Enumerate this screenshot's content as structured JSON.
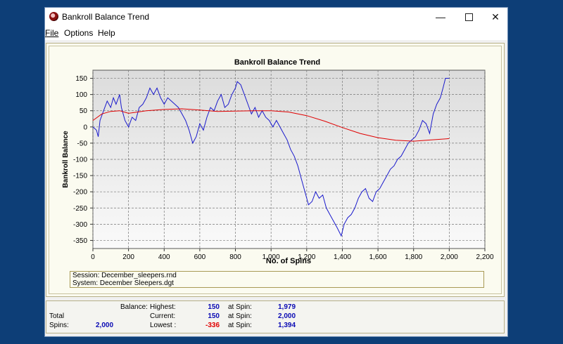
{
  "window": {
    "title": "Bankroll Balance Trend"
  },
  "menu": {
    "file": "File",
    "options": "Options",
    "help": "Help"
  },
  "chart_data": {
    "type": "line",
    "title": "Bankroll Balance Trend",
    "xlabel": "No. of Spins",
    "ylabel": "Bankroll Balance",
    "xlim": [
      0,
      2200
    ],
    "ylim": [
      -375,
      175
    ],
    "x_ticks": [
      "0",
      "200",
      "400",
      "600",
      "800",
      "1,000",
      "1,200",
      "1,400",
      "1,600",
      "1,800",
      "2,000",
      "2,200"
    ],
    "y_ticks": [
      "150",
      "100",
      "50",
      "0",
      "-50",
      "-100",
      "-150",
      "-200",
      "-250",
      "-300",
      "-350"
    ],
    "grid": true,
    "series": [
      {
        "color": "#1a1acc",
        "points": [
          [
            0,
            0
          ],
          [
            20,
            -10
          ],
          [
            30,
            -30
          ],
          [
            40,
            20
          ],
          [
            60,
            50
          ],
          [
            80,
            80
          ],
          [
            100,
            60
          ],
          [
            115,
            90
          ],
          [
            130,
            70
          ],
          [
            150,
            100
          ],
          [
            160,
            60
          ],
          [
            180,
            20
          ],
          [
            200,
            0
          ],
          [
            220,
            30
          ],
          [
            240,
            20
          ],
          [
            260,
            60
          ],
          [
            280,
            70
          ],
          [
            300,
            90
          ],
          [
            320,
            120
          ],
          [
            340,
            100
          ],
          [
            360,
            120
          ],
          [
            380,
            90
          ],
          [
            400,
            70
          ],
          [
            420,
            90
          ],
          [
            440,
            80
          ],
          [
            460,
            70
          ],
          [
            480,
            60
          ],
          [
            500,
            40
          ],
          [
            520,
            20
          ],
          [
            540,
            -10
          ],
          [
            560,
            -50
          ],
          [
            580,
            -30
          ],
          [
            600,
            10
          ],
          [
            620,
            -10
          ],
          [
            640,
            30
          ],
          [
            660,
            60
          ],
          [
            680,
            50
          ],
          [
            700,
            80
          ],
          [
            720,
            100
          ],
          [
            740,
            60
          ],
          [
            760,
            70
          ],
          [
            780,
            100
          ],
          [
            800,
            120
          ],
          [
            810,
            140
          ],
          [
            830,
            130
          ],
          [
            850,
            100
          ],
          [
            870,
            70
          ],
          [
            890,
            40
          ],
          [
            910,
            60
          ],
          [
            930,
            30
          ],
          [
            950,
            50
          ],
          [
            970,
            30
          ],
          [
            990,
            20
          ],
          [
            1010,
            0
          ],
          [
            1030,
            20
          ],
          [
            1050,
            0
          ],
          [
            1070,
            -20
          ],
          [
            1090,
            -40
          ],
          [
            1110,
            -70
          ],
          [
            1130,
            -90
          ],
          [
            1150,
            -120
          ],
          [
            1170,
            -160
          ],
          [
            1190,
            -200
          ],
          [
            1210,
            -240
          ],
          [
            1230,
            -230
          ],
          [
            1250,
            -200
          ],
          [
            1270,
            -220
          ],
          [
            1290,
            -210
          ],
          [
            1310,
            -250
          ],
          [
            1330,
            -270
          ],
          [
            1350,
            -290
          ],
          [
            1370,
            -310
          ],
          [
            1394,
            -336
          ],
          [
            1410,
            -300
          ],
          [
            1430,
            -280
          ],
          [
            1450,
            -270
          ],
          [
            1470,
            -250
          ],
          [
            1490,
            -220
          ],
          [
            1510,
            -200
          ],
          [
            1530,
            -190
          ],
          [
            1550,
            -220
          ],
          [
            1570,
            -230
          ],
          [
            1590,
            -200
          ],
          [
            1610,
            -190
          ],
          [
            1630,
            -170
          ],
          [
            1650,
            -150
          ],
          [
            1670,
            -130
          ],
          [
            1690,
            -120
          ],
          [
            1710,
            -100
          ],
          [
            1730,
            -90
          ],
          [
            1750,
            -70
          ],
          [
            1770,
            -50
          ],
          [
            1790,
            -40
          ],
          [
            1810,
            -30
          ],
          [
            1830,
            -10
          ],
          [
            1850,
            20
          ],
          [
            1870,
            10
          ],
          [
            1890,
            -20
          ],
          [
            1910,
            40
          ],
          [
            1930,
            70
          ],
          [
            1950,
            90
          ],
          [
            1965,
            120
          ],
          [
            1979,
            150
          ],
          [
            2000,
            150
          ]
        ]
      },
      {
        "color": "#e00000",
        "points": [
          [
            0,
            20
          ],
          [
            50,
            40
          ],
          [
            100,
            48
          ],
          [
            150,
            50
          ],
          [
            200,
            42
          ],
          [
            250,
            46
          ],
          [
            300,
            50
          ],
          [
            400,
            54
          ],
          [
            500,
            56
          ],
          [
            600,
            52
          ],
          [
            700,
            48
          ],
          [
            800,
            49
          ],
          [
            900,
            50
          ],
          [
            1000,
            50
          ],
          [
            1100,
            46
          ],
          [
            1200,
            35
          ],
          [
            1300,
            18
          ],
          [
            1400,
            -2
          ],
          [
            1500,
            -20
          ],
          [
            1600,
            -33
          ],
          [
            1700,
            -41
          ],
          [
            1800,
            -44
          ],
          [
            1900,
            -40
          ],
          [
            2000,
            -36
          ]
        ]
      }
    ]
  },
  "info": {
    "session": "Session: December_sleepers.rnd",
    "system": "System: December Sleepers.dgt"
  },
  "stats": {
    "balance_label": "Balance:",
    "total_label": "Total",
    "spins_label": "Spins:",
    "spins_value": "2,000",
    "highest_label": "Highest:",
    "highest_value": "150",
    "current_label": "Current:",
    "current_value": "150",
    "lowest_label": "Lowest :",
    "lowest_value": "-336",
    "at_spin_label": "at Spin:",
    "highest_spin": "1,979",
    "current_spin": "2,000",
    "lowest_spin": "1,394"
  }
}
